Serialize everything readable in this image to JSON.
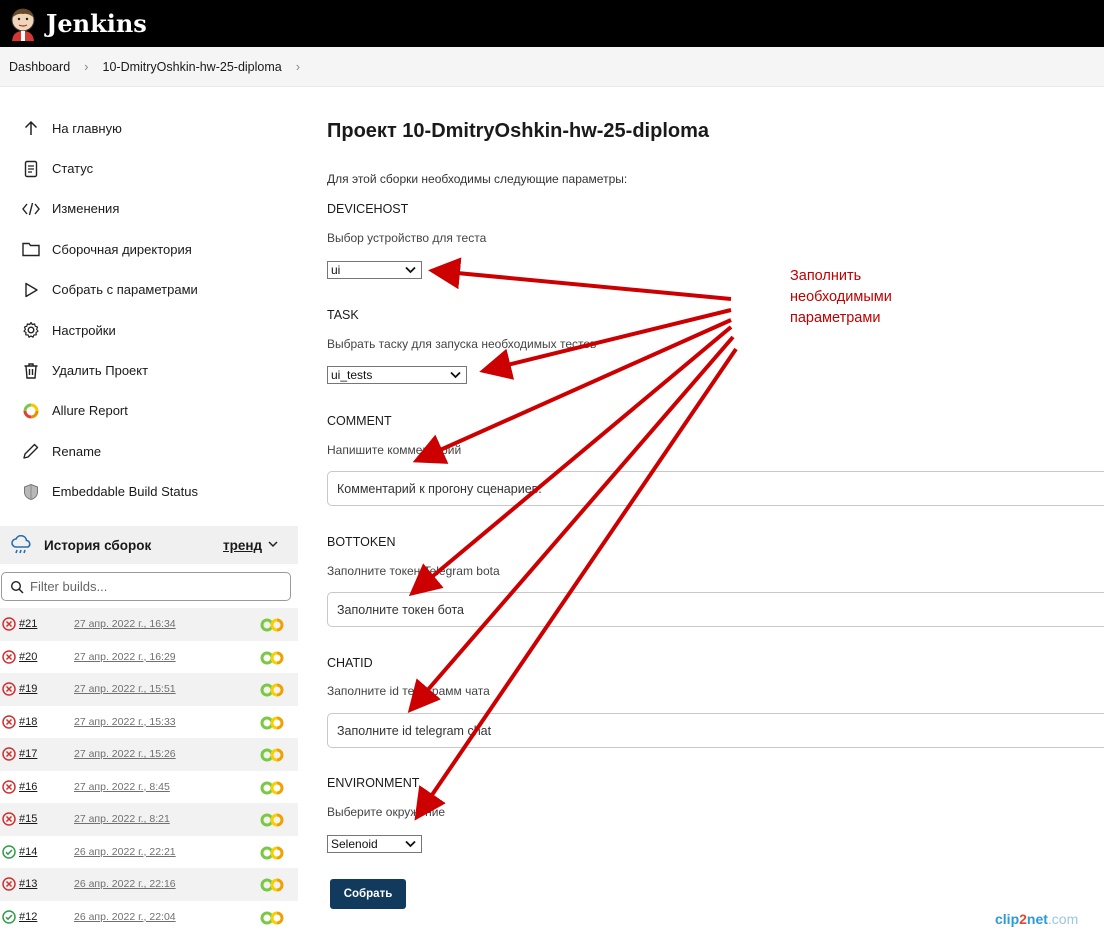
{
  "header": {
    "app_name": "Jenkins"
  },
  "breadcrumb": {
    "items": [
      "Dashboard",
      "10-DmitryOshkin-hw-25-diploma"
    ]
  },
  "sidebar": {
    "items": [
      {
        "label": "На главную",
        "icon": "arrow-up-icon"
      },
      {
        "label": "Статус",
        "icon": "document-icon"
      },
      {
        "label": "Изменения",
        "icon": "code-icon"
      },
      {
        "label": "Сборочная директория",
        "icon": "folder-icon"
      },
      {
        "label": "Собрать с параметрами",
        "icon": "play-icon"
      },
      {
        "label": "Настройки",
        "icon": "gear-icon"
      },
      {
        "label": "Удалить Проект",
        "icon": "trash-icon"
      },
      {
        "label": "Allure Report",
        "icon": "allure-icon"
      },
      {
        "label": "Rename",
        "icon": "pencil-icon"
      },
      {
        "label": "Embeddable Build Status",
        "icon": "shield-icon"
      }
    ]
  },
  "history": {
    "title": "История сборок",
    "trend_label": "тренд",
    "filter_placeholder": "Filter builds...",
    "builds": [
      {
        "number": "#21",
        "date": "27 апр. 2022 г., 16:34",
        "status": "failed"
      },
      {
        "number": "#20",
        "date": "27 апр. 2022 г., 16:29",
        "status": "failed"
      },
      {
        "number": "#19",
        "date": "27 апр. 2022 г., 15:51",
        "status": "failed"
      },
      {
        "number": "#18",
        "date": "27 апр. 2022 г., 15:33",
        "status": "failed"
      },
      {
        "number": "#17",
        "date": "27 апр. 2022 г., 15:26",
        "status": "failed"
      },
      {
        "number": "#16",
        "date": "27 апр. 2022 г., 8:45",
        "status": "failed"
      },
      {
        "number": "#15",
        "date": "27 апр. 2022 г., 8:21",
        "status": "failed"
      },
      {
        "number": "#14",
        "date": "26 апр. 2022 г., 22:21",
        "status": "success"
      },
      {
        "number": "#13",
        "date": "26 апр. 2022 г., 22:16",
        "status": "failed"
      },
      {
        "number": "#12",
        "date": "26 апр. 2022 г., 22:04",
        "status": "success"
      }
    ]
  },
  "main": {
    "title": "Проект 10-DmitryOshkin-hw-25-diploma",
    "intro": "Для этой сборки необходимы следующие параметры:",
    "params": {
      "devicehost": {
        "name": "DEVICEHOST",
        "description": "Выбор устройство для теста",
        "value": "ui"
      },
      "task": {
        "name": "TASK",
        "description": "Выбрать таску для запуска необходимых тестов",
        "value": "ui_tests"
      },
      "comment": {
        "name": "COMMENT",
        "description": "Напишите комментарий",
        "placeholder": "Комментарий к прогону сценариев."
      },
      "bottoken": {
        "name": "BOTTOKEN",
        "description": "Заполните токен Telegram bota",
        "placeholder": "Заполните токен бота"
      },
      "chatid": {
        "name": "CHATID",
        "description": "Заполните id телеграмм чата",
        "placeholder": "Заполните id telegram chat"
      },
      "environment": {
        "name": "ENVIRONMENT",
        "description": "Выберите окружение",
        "value": "Selenoid"
      }
    },
    "submit_label": "Собрать"
  },
  "annotation": {
    "lines": [
      "Заполнить",
      "необходимыми",
      "параметрами"
    ],
    "color": "#cc0000"
  },
  "watermark": {
    "part1": "clip",
    "part2": "2",
    "part3": "net",
    "part4": ".com"
  },
  "colors": {
    "header_bg": "#000000",
    "submit_bg": "#123a5c",
    "failed": "#d32f2f",
    "success": "#2e9e44"
  }
}
